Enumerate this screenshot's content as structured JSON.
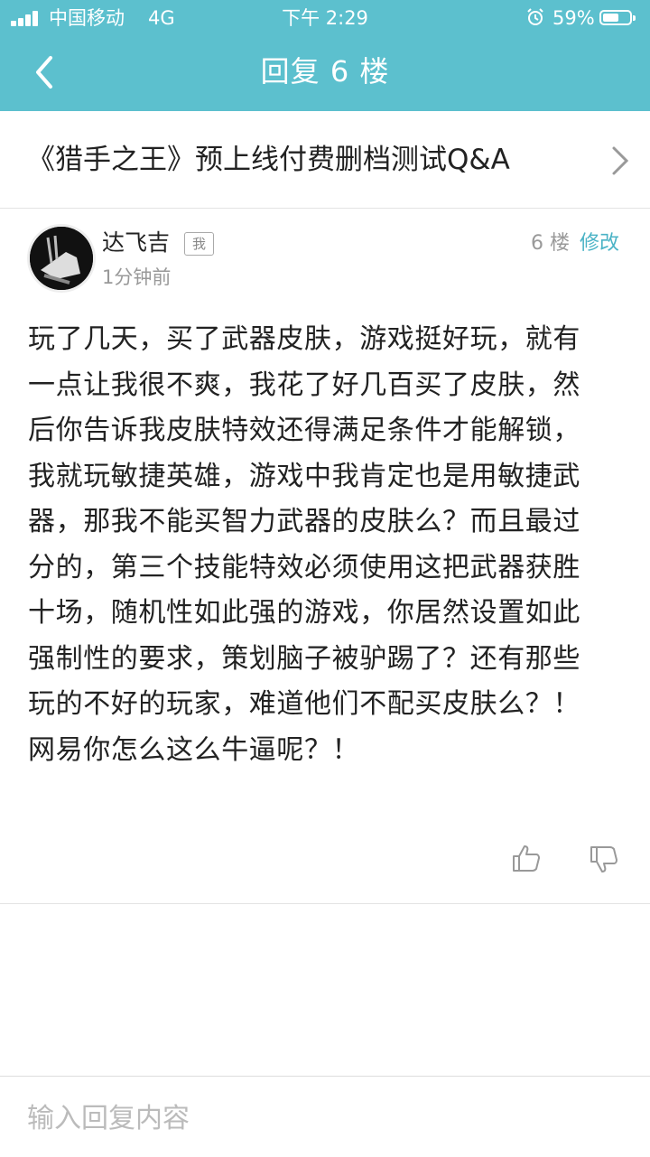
{
  "status_bar": {
    "carrier": "中国移动",
    "network": "4G",
    "time": "下午 2:29",
    "battery_percent": "59%",
    "battery_level": 0.59
  },
  "nav": {
    "title": "回复 6 楼",
    "back_icon": "chevron-left-icon"
  },
  "thread": {
    "title": "《猎手之王》预上线付费删档测试Q&A"
  },
  "post": {
    "username": "达飞吉",
    "me_badge": "我",
    "time": "1分钟前",
    "floor": "6 楼",
    "edit_label": "修改",
    "content": "玩了几天，买了武器皮肤，游戏挺好玩，就有一点让我很不爽，我花了好几百买了皮肤，然后你告诉我皮肤特效还得满足条件才能解锁，我就玩敏捷英雄，游戏中我肯定也是用敏捷武器，那我不能买智力武器的皮肤么？而且最过分的，第三个技能特效必须使用这把武器获胜十场，随机性如此强的游戏，你居然设置如此强制性的要求，策划脑子被驴踢了？还有那些玩的不好的玩家，难道他们不配买皮肤么？！ 网易你怎么这么牛逼呢？！"
  },
  "reply": {
    "placeholder": "输入回复内容",
    "value": ""
  },
  "colors": {
    "header": "#5cc0ce",
    "accent": "#4bb3c6"
  }
}
